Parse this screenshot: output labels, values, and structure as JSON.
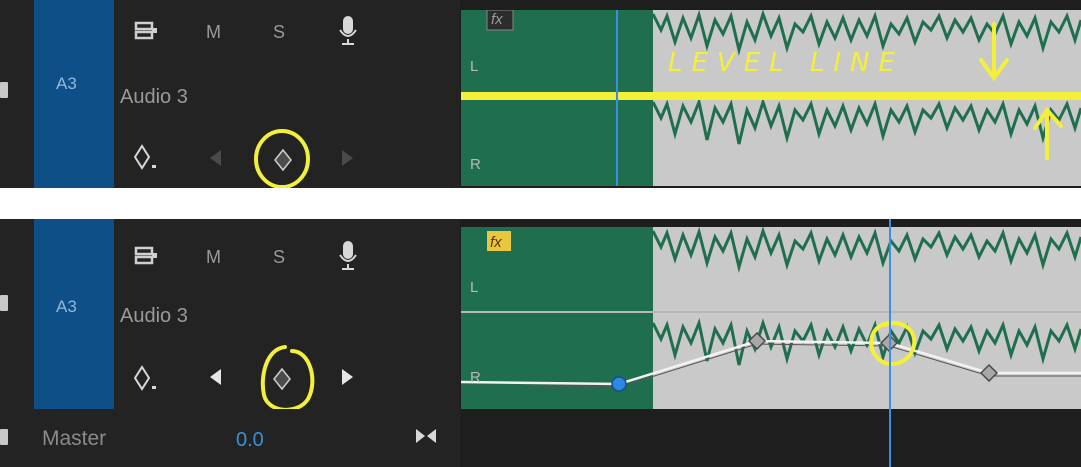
{
  "tracks": [
    {
      "id": "A3",
      "name": "Audio 3",
      "m_label": "M",
      "s_label": "S",
      "clip_fx": "fx",
      "channel_left": "L",
      "channel_right": "R",
      "annotation": "LEVEL LINE",
      "fx_color": "#9a9a9a"
    },
    {
      "id": "A3",
      "name": "Audio 3",
      "m_label": "M",
      "s_label": "S",
      "clip_fx": "fx",
      "channel_left": "L",
      "channel_right": "R",
      "fx_color": "#e8c640"
    }
  ],
  "master": {
    "label": "Master",
    "value": "0.0"
  },
  "colors": {
    "waveform": "#1f6e4e",
    "clip_background": "#c9c9c9",
    "track_target": "#0e4f87",
    "playhead": "#3a8ee6",
    "annotation": "#f4f03a",
    "keyframe_selected": "#2a8ae6"
  }
}
